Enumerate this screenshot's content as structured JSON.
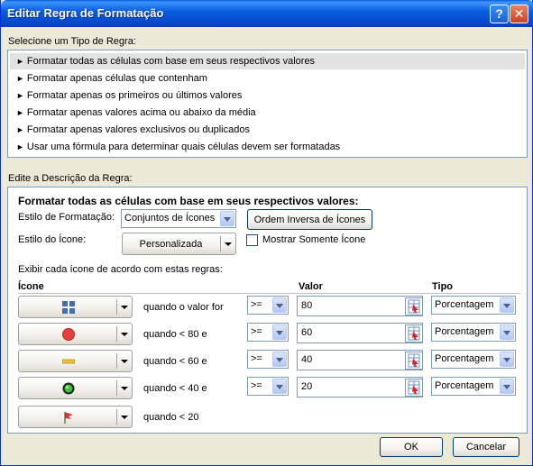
{
  "dialog": {
    "title": "Editar Regra de Formatação",
    "help_symbol": "?",
    "close_symbol": "✕"
  },
  "rule_types": {
    "label": "Selecione um Tipo de Regra:",
    "items": [
      "Formatar todas as células com base em seus respectivos valores",
      "Formatar apenas células que contenham",
      "Formatar apenas os primeiros ou últimos valores",
      "Formatar apenas valores acima ou abaixo da média",
      "Formatar apenas valores exclusivos ou duplicados",
      "Usar uma fórmula para determinar quais células devem ser formatadas"
    ],
    "selected_index": 0
  },
  "description": {
    "label": "Edite a Descrição da Regra:",
    "heading": "Formatar todas as células com base em seus respectivos valores:",
    "format_style_label": "Estilo de Formatação:",
    "format_style_value": "Conjuntos de Ícones",
    "reverse_button": "Ordem Inversa de Ícones",
    "icon_style_label": "Estilo do Ícone:",
    "icon_style_value": "Personalizada",
    "show_icon_only_label": "Mostrar Somente Ícone",
    "show_icon_only_checked": false,
    "rules_caption": "Exibir cada ícone de acordo com estas regras:",
    "col_icon": "Ícone",
    "col_value": "Valor",
    "col_type": "Tipo"
  },
  "rows": [
    {
      "icon": "four-squares-icon",
      "condition": "quando o valor for",
      "operator": ">=",
      "value": "80",
      "type": "Porcentagem"
    },
    {
      "icon": "red-circle-icon",
      "condition": "quando < 80 e",
      "operator": ">=",
      "value": "60",
      "type": "Porcentagem"
    },
    {
      "icon": "yellow-dash-icon",
      "condition": "quando < 60 e",
      "operator": ">=",
      "value": "40",
      "type": "Porcentagem"
    },
    {
      "icon": "green-light-icon",
      "condition": "quando < 40 e",
      "operator": ">=",
      "value": "20",
      "type": "Porcentagem"
    },
    {
      "icon": "red-flag-icon",
      "condition": "quando < 20"
    }
  ],
  "footer": {
    "ok": "OK",
    "cancel": "Cancelar"
  },
  "colors": {
    "titlebar": "#0a5bd6",
    "dialog_bg": "#ece9d8",
    "selection": "#e2e2e2"
  }
}
